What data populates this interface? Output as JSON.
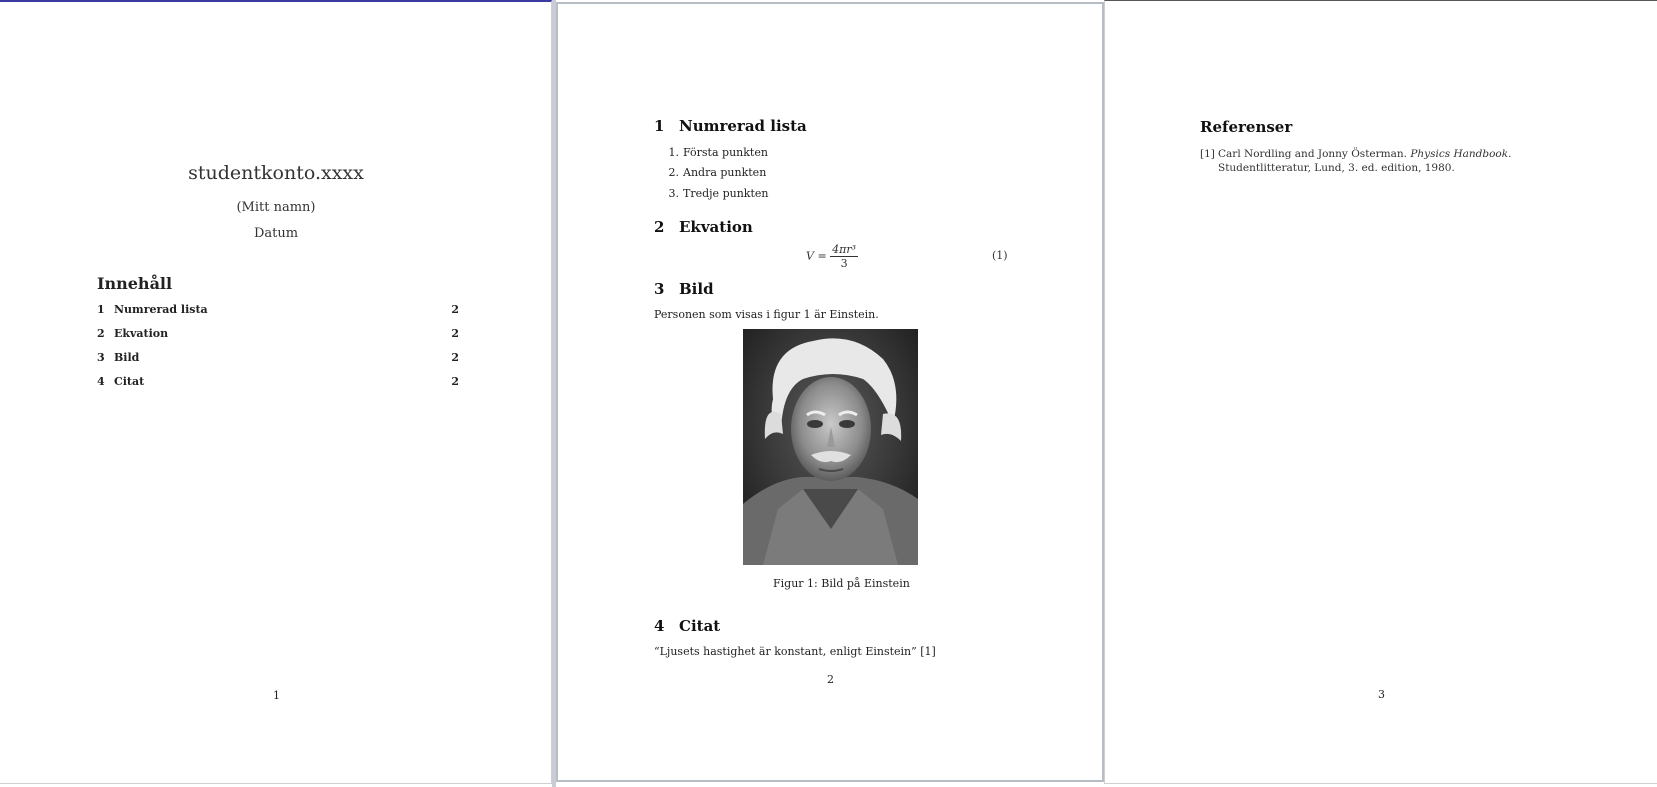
{
  "page1": {
    "title": "studentkonto.xxxx",
    "author": "(Mitt namn)",
    "date": "Datum",
    "toc_heading": "Innehåll",
    "toc": [
      {
        "num": "1",
        "text": "Numrerad lista",
        "page": "2"
      },
      {
        "num": "2",
        "text": "Ekvation",
        "page": "2"
      },
      {
        "num": "3",
        "text": "Bild",
        "page": "2"
      },
      {
        "num": "4",
        "text": "Citat",
        "page": "2"
      }
    ],
    "page_number": "1"
  },
  "page2": {
    "sections": [
      {
        "num": "1",
        "title": "Numrerad lista"
      },
      {
        "num": "2",
        "title": "Ekvation"
      },
      {
        "num": "3",
        "title": "Bild"
      },
      {
        "num": "4",
        "title": "Citat"
      }
    ],
    "list": [
      {
        "num": "1.",
        "text": "Första punkten"
      },
      {
        "num": "2.",
        "text": "Andra punkten"
      },
      {
        "num": "3.",
        "text": "Tredje punkten"
      }
    ],
    "equation": {
      "lhs": "V =",
      "numerator": "4πr³",
      "denominator": "3",
      "number": "(1)"
    },
    "bild_text": "Personen som visas i figur 1 är Einstein.",
    "figure_caption": "Figur 1: Bild på Einstein",
    "quote": "“Ljusets hastighet är konstant, enligt Einstein” [1]",
    "page_number": "2"
  },
  "page3": {
    "heading": "Referenser",
    "ref_label": "[1]",
    "ref_authors": "Carl Nordling and Jonny Österman.",
    "ref_title": "Physics Handbook.",
    "ref_rest": "Studentlitteratur, Lund, 3. ed. edition, 1980.",
    "page_number": "3"
  }
}
